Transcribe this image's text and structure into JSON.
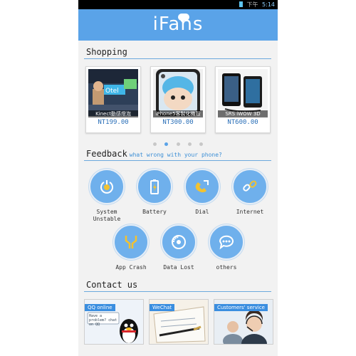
{
  "status": {
    "time": "5:14",
    "signal": "下午"
  },
  "header": {
    "logo": "iFans"
  },
  "shopping": {
    "title": "Shopping",
    "products": [
      {
        "caption": "Kinect動感燈泡",
        "price": "NT199.00"
      },
      {
        "caption": "iPhone5客製化機殼",
        "price": "NT300.00"
      },
      {
        "caption": "SRS iWOW 3D",
        "price": "NT600.00"
      }
    ],
    "pager": {
      "pages": 5,
      "current": 2
    }
  },
  "feedback": {
    "title": "Feedback",
    "subtitle": "what wrong with your phone?",
    "items": [
      {
        "label": "System Unstable",
        "icon": "power-icon"
      },
      {
        "label": "Battery",
        "icon": "battery-icon"
      },
      {
        "label": "Dial",
        "icon": "phone-icon"
      },
      {
        "label": "Internet",
        "icon": "link-icon"
      },
      {
        "label": "App Crash",
        "icon": "broken-app-icon"
      },
      {
        "label": "Data Lost",
        "icon": "disc-icon"
      },
      {
        "label": "others",
        "icon": "chat-dots-icon"
      }
    ]
  },
  "contact": {
    "title": "Contact us",
    "items": [
      {
        "label": "QQ online",
        "bubble": "Have a problem? chat on QQ"
      },
      {
        "label": "WeChat"
      },
      {
        "label": "Customers' service"
      }
    ]
  },
  "colors": {
    "accent": "#5aa3e8",
    "icon_bg": "#6fb0ec",
    "price": "#2a6fb8"
  }
}
